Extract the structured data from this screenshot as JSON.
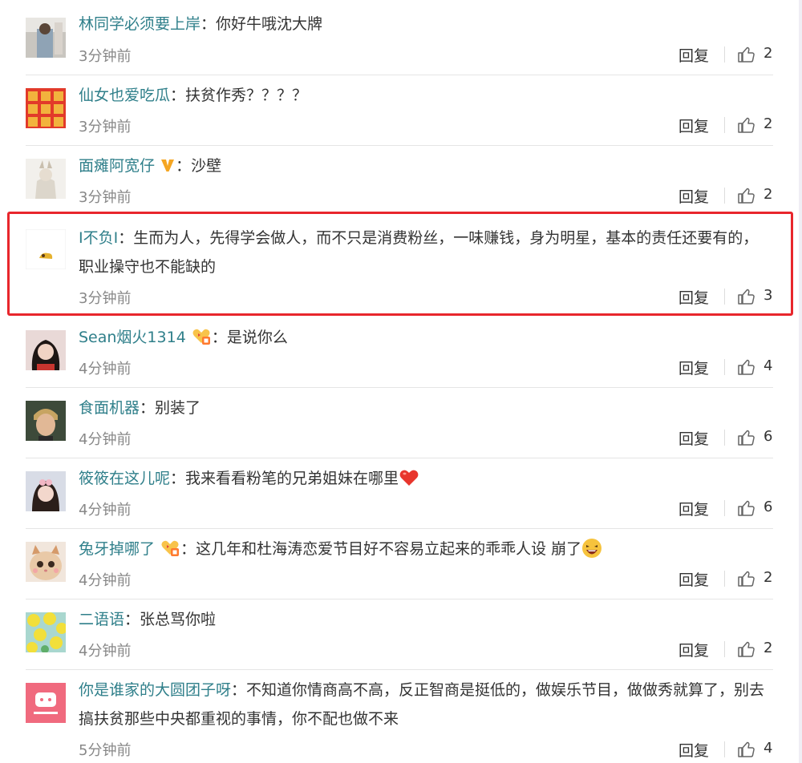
{
  "comments": [
    {
      "name": "林同学必须要上岸",
      "colon": "：",
      "text": "你好牛哦沈大牌",
      "time": "3分钟前",
      "reply": "回复",
      "likes": "2",
      "badge": "",
      "emoji": ""
    },
    {
      "name": "仙女也爱吃瓜",
      "colon": "：",
      "text": "扶贫作秀？？？？",
      "time": "3分钟前",
      "reply": "回复",
      "likes": "2",
      "badge": "",
      "emoji": ""
    },
    {
      "name": "面瘫阿宽仔",
      "colon": "：",
      "text": "沙壁",
      "time": "3分钟前",
      "reply": "回复",
      "likes": "2",
      "badge": "v-badge-icon",
      "emoji": ""
    },
    {
      "name": "I不负I",
      "colon": "：",
      "text": "生而为人，先得学会做人，而不只是消费粉丝，一味赚钱，身为明星，基本的责任还要有的，职业操守也不能缺的",
      "time": "3分钟前",
      "reply": "回复",
      "likes": "3",
      "badge": "",
      "emoji": ""
    },
    {
      "name": "Sean烟火1314",
      "colon": "：",
      "text": "是说你么",
      "time": "4分钟前",
      "reply": "回复",
      "likes": "4",
      "badge": "fan-heart-badge-icon",
      "emoji": ""
    },
    {
      "name": "食面机器",
      "colon": "：",
      "text": "别装了",
      "time": "4分钟前",
      "reply": "回复",
      "likes": "6",
      "badge": "",
      "emoji": ""
    },
    {
      "name": "筱筱在这儿呢",
      "colon": "：",
      "text": "我来看看粉笔的兄弟姐妹在哪里",
      "time": "4分钟前",
      "reply": "回复",
      "likes": "6",
      "badge": "",
      "emoji": "red-heart-emoji"
    },
    {
      "name": "兔牙掉哪了",
      "colon": "：",
      "text": "这几年和杜海涛恋爱节目好不容易立起来的乖乖人设 崩了",
      "time": "4分钟前",
      "reply": "回复",
      "likes": "2",
      "badge": "fan-heart-badge-icon",
      "emoji": "laughing-emoji"
    },
    {
      "name": "二语语",
      "colon": "：",
      "text": "张总骂你啦",
      "time": "4分钟前",
      "reply": "回复",
      "likes": "2",
      "badge": "",
      "emoji": ""
    },
    {
      "name": "你是谁家的大圆团子呀",
      "colon": "：",
      "text": "不知道你情商高不高，反正智商是挺低的，做娱乐节目，做做秀就算了，别去搞扶贫那些中央都重视的事情，你不配也做不来",
      "time": "5分钟前",
      "reply": "回复",
      "likes": "4",
      "badge": "",
      "emoji": ""
    }
  ],
  "colors": {
    "name": "#2f7f8a",
    "highlight": "#e8262c",
    "time": "#888888"
  }
}
